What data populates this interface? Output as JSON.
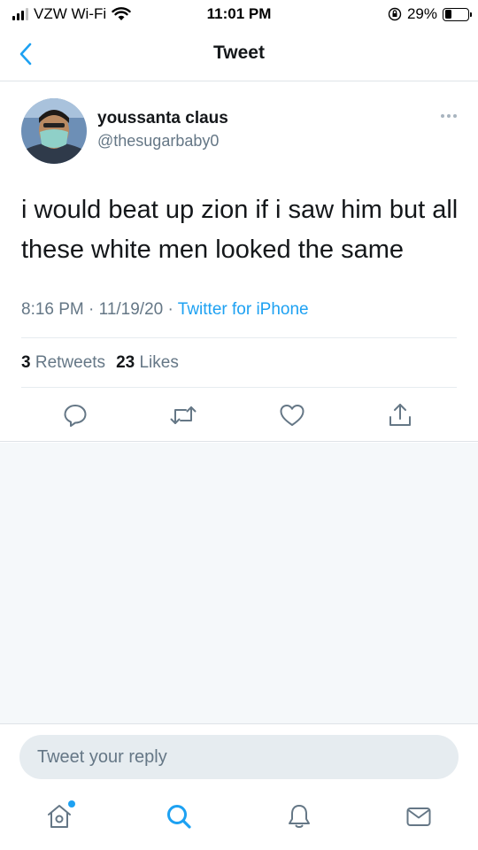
{
  "status_bar": {
    "carrier": "VZW Wi-Fi",
    "time": "11:01 PM",
    "battery": "29%",
    "battery_level": 0.29
  },
  "nav": {
    "title": "Tweet",
    "back_icon": "chevron-left-icon"
  },
  "tweet": {
    "author_name": "youssanta claus",
    "author_handle": "@thesugarbaby0",
    "text": "i would beat up zion if i saw him but all these white men looked the same",
    "time": "8:16 PM",
    "date": "11/19/20",
    "separator": "·",
    "source": "Twitter for iPhone",
    "retweets_count": "3",
    "retweets_label": "Retweets",
    "likes_count": "23",
    "likes_label": "Likes"
  },
  "actions": [
    "reply-icon",
    "retweet-icon",
    "like-icon",
    "share-icon"
  ],
  "reply": {
    "placeholder": "Tweet your reply"
  },
  "tab_bar": [
    "home-icon",
    "search-icon",
    "notifications-icon",
    "messages-icon"
  ],
  "colors": {
    "accent": "#1da1f2",
    "secondary_text": "#657786",
    "icon_gray": "#657786"
  }
}
